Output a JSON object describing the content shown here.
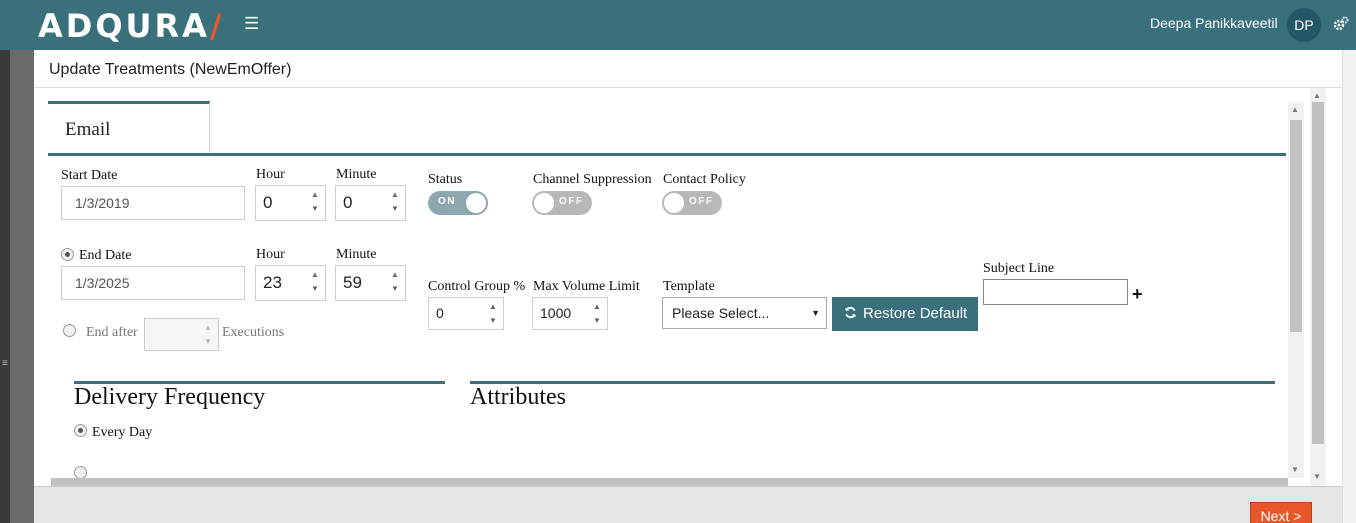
{
  "app": {
    "logo": "ADQURA",
    "logo_slash": "/",
    "menu_icon": "hamburger-icon"
  },
  "user": {
    "name": "Deepa Panikkaveetil",
    "initials": "DP",
    "settings_icon": "gear-icon"
  },
  "modal": {
    "title": "Update Treatments (NewEmOffer)"
  },
  "tab": {
    "label": "Email"
  },
  "schedule": {
    "start_date_label": "Start Date",
    "start_date_value": "1/3/2019",
    "hour_label": "Hour",
    "minute_label": "Minute",
    "start_hour": "0",
    "start_minute": "0",
    "end_date_label": "End Date",
    "end_date_value": "1/3/2025",
    "end_hour": "23",
    "end_minute": "59",
    "end_after_label": "End after",
    "executions_label": "Executions",
    "end_after_value": ""
  },
  "status": {
    "label": "Status",
    "value": "ON"
  },
  "channel_suppression": {
    "label": "Channel Suppression",
    "value": "OFF"
  },
  "contact_policy": {
    "label": "Contact Policy",
    "value": "OFF"
  },
  "control_group": {
    "label": "Control Group %",
    "value": "0"
  },
  "max_volume": {
    "label": "Max Volume Limit",
    "value": "1000"
  },
  "template": {
    "label": "Template",
    "selected": "Please Select..."
  },
  "restore_button": {
    "label": "Restore Default",
    "icon": "refresh-icon"
  },
  "subject_line": {
    "label": "Subject Line",
    "value": "",
    "add_icon": "plus-icon"
  },
  "delivery_frequency": {
    "title": "Delivery Frequency",
    "option_every_day": "Every Day"
  },
  "attributes": {
    "title": "Attributes"
  },
  "footer": {
    "next_label": "Next >"
  },
  "colors": {
    "primary": "#3a6f7c",
    "accent": "#e8572a"
  }
}
